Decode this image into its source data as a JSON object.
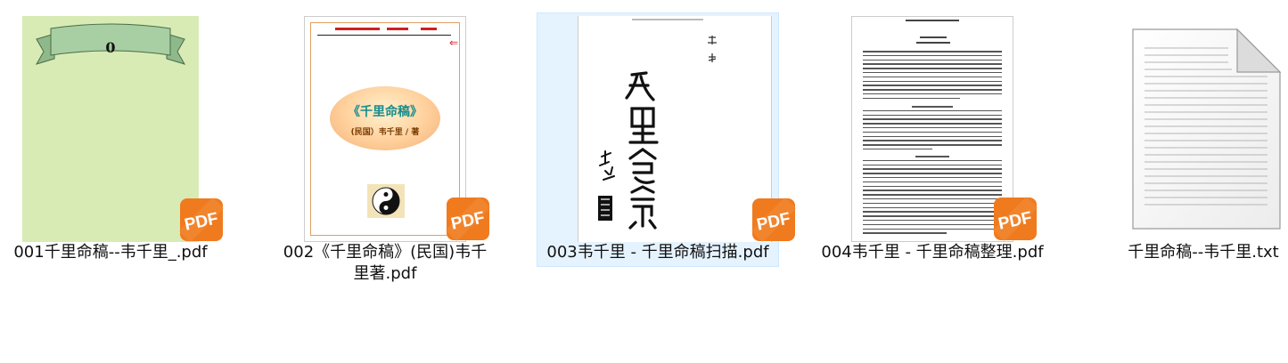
{
  "files": [
    {
      "label": "001千里命稿--韦千里_.pdf",
      "type": "pdf",
      "cover_banner_text": "0"
    },
    {
      "label": "002《千里命稿》(民国)韦千里著.pdf",
      "type": "pdf",
      "cover_title": "《千里命稿》",
      "cover_subtitle": "(民国）韦千里 / 著"
    },
    {
      "label": "003韦千里 - 千里命稿扫描.pdf",
      "type": "pdf",
      "selected": true
    },
    {
      "label": "004韦千里 - 千里命稿整理.pdf",
      "type": "pdf"
    },
    {
      "label": "千里命稿--韦千里.txt",
      "type": "txt"
    }
  ],
  "colors": {
    "selection_bg": "#e5f3ff",
    "pdf_badge": "#f07a1e",
    "thumb1_bg": "#d8ebb5"
  }
}
